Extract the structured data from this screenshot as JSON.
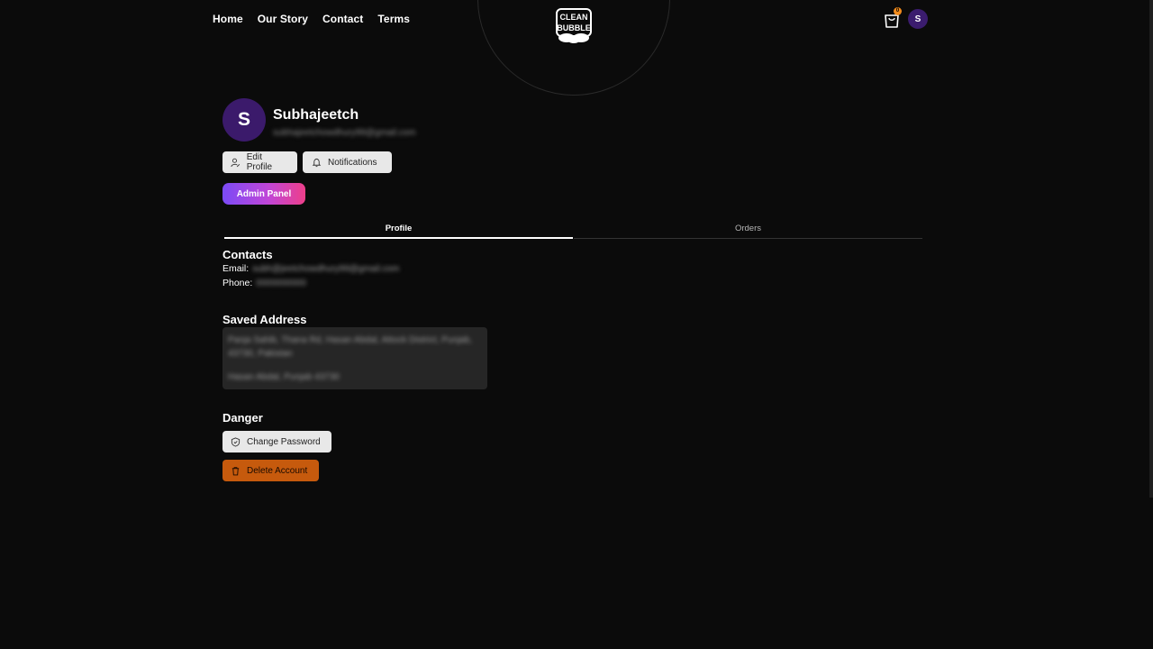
{
  "nav": {
    "items": [
      {
        "label": "Home"
      },
      {
        "label": "Our Story"
      },
      {
        "label": "Contact"
      },
      {
        "label": "Terms"
      }
    ]
  },
  "brand": {
    "logo_text": "CLEAN BUBBLE"
  },
  "cart": {
    "count": "0",
    "icon": "shopping-bag-icon"
  },
  "user": {
    "initial": "S",
    "name": "Subhajeetch",
    "email_blurred": "subhajeetchowdhury99@gmail.com"
  },
  "actions": {
    "edit_profile": "Edit Profile",
    "notifications": "Notifications",
    "admin_panel": "Admin Panel"
  },
  "tabs": [
    {
      "label": "Profile",
      "active": true
    },
    {
      "label": "Orders",
      "active": false
    }
  ],
  "contacts": {
    "title": "Contacts",
    "email_label": "Email:",
    "email_value": "subh@jeetchowdhury99@gmail.com",
    "phone_label": "Phone:",
    "phone_value": "0000000000"
  },
  "address": {
    "title": "Saved Address",
    "line1": "Panja Sahib, Thana Rd, Hasan Abdal, Attock District, Punjab, 43730, Pakistan",
    "line2": "Hasan Abdal, Punjab 43730"
  },
  "danger": {
    "title": "Danger",
    "change_password": "Change Password",
    "delete_account": "Delete Account"
  },
  "colors": {
    "background": "#0b0b0b",
    "avatar": "#3b1a6b",
    "admin_gradient_start": "#7b4bf6",
    "admin_gradient_end": "#ee3f8a",
    "delete": "#c65a0d",
    "cart_badge": "#f08a1c"
  }
}
